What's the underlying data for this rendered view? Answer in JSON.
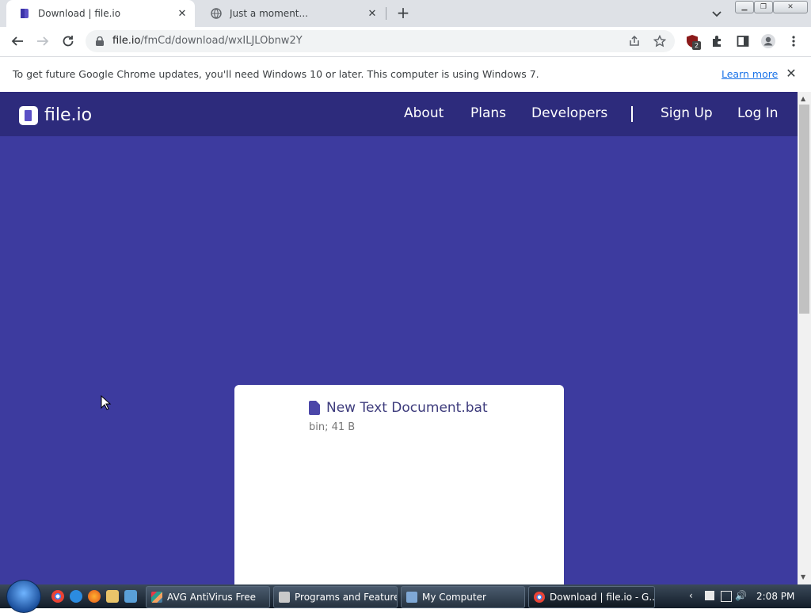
{
  "browser": {
    "tabs": [
      {
        "title": "Download | file.io",
        "active": true
      },
      {
        "title": "Just a moment...",
        "active": false
      }
    ],
    "new_tab": "+",
    "url_domain": "file.io",
    "url_path": "/fmCd/download/wxILJLObnw2Y",
    "extension_badge": "2"
  },
  "infobar": {
    "message": "To get future Google Chrome updates, you'll need Windows 10 or later. This computer is using Windows 7.",
    "learn_more": "Learn more"
  },
  "site": {
    "logo_text": "file.io",
    "nav": {
      "about": "About",
      "plans": "Plans",
      "developers": "Developers",
      "sign_up": "Sign Up",
      "log_in": "Log In"
    },
    "file": {
      "name": "New Text Document.bat",
      "meta": "bin; 41 B"
    }
  },
  "taskbar": {
    "buttons": [
      {
        "label": "AVG AntiVirus Free"
      },
      {
        "label": "Programs and Features"
      },
      {
        "label": "My Computer"
      },
      {
        "label": "Download | file.io - G..."
      }
    ],
    "clock": "2:08 PM"
  },
  "colors": {
    "page_bg": "#3d3b9f",
    "navbar_bg": "#2d2b7c",
    "link": "#1a73e8"
  }
}
